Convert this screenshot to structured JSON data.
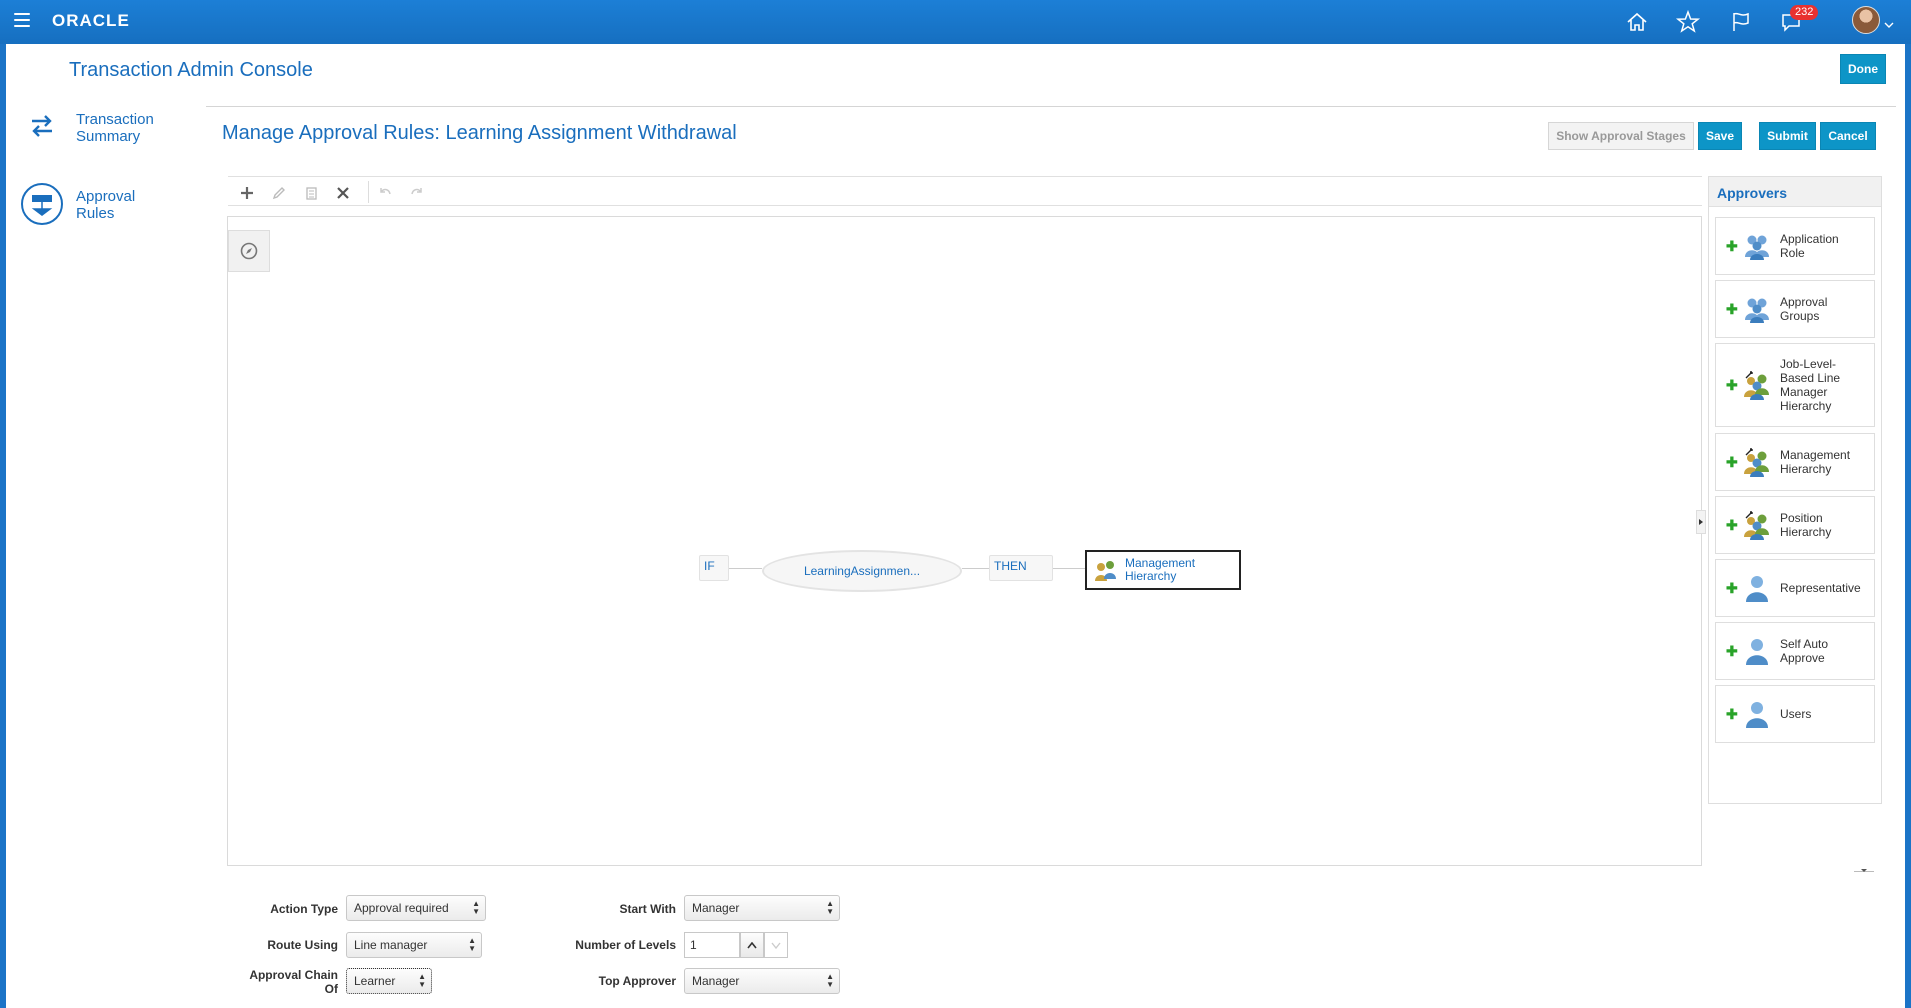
{
  "topbar": {
    "logo": "ORACLE",
    "notification_count": "232"
  },
  "console": {
    "title": "Transaction Admin Console",
    "done_label": "Done"
  },
  "nav": {
    "items": [
      {
        "label_line1": "Transaction",
        "label_line2": "Summary"
      },
      {
        "label_line1": "Approval",
        "label_line2": "Rules"
      }
    ]
  },
  "page": {
    "title": "Manage Approval Rules: Learning Assignment Withdrawal",
    "show_stages_label": "Show Approval Stages",
    "save_label": "Save",
    "submit_label": "Submit",
    "cancel_label": "Cancel"
  },
  "rule": {
    "if_label": "IF",
    "condition_label": "LearningAssignmen...",
    "then_label": "THEN",
    "action_line1": "Management",
    "action_line2": "Hierarchy"
  },
  "approvers": {
    "title": "Approvers",
    "items": [
      {
        "lines": [
          "Application",
          "Role"
        ],
        "icon": "group-icon"
      },
      {
        "lines": [
          "Approval",
          "Groups"
        ],
        "icon": "group-icon"
      },
      {
        "lines": [
          "Job-Level-",
          "Based Line",
          "Manager",
          "Hierarchy"
        ],
        "icon": "hierarchy-icon"
      },
      {
        "lines": [
          "Management",
          "Hierarchy"
        ],
        "icon": "hierarchy-icon"
      },
      {
        "lines": [
          "Position",
          "Hierarchy"
        ],
        "icon": "hierarchy-icon"
      },
      {
        "lines": [
          "Representative"
        ],
        "icon": "user-icon"
      },
      {
        "lines": [
          "Self Auto",
          "Approve"
        ],
        "icon": "user-icon"
      },
      {
        "lines": [
          "Users"
        ],
        "icon": "user-icon"
      }
    ]
  },
  "form": {
    "action_type_label": "Action Type",
    "action_type_value": "Approval required",
    "route_using_label": "Route Using",
    "route_using_value": "Line manager",
    "approval_chain_label_line1": "Approval Chain",
    "approval_chain_label_line2": "Of",
    "approval_chain_value": "Learner",
    "start_with_label": "Start With",
    "start_with_value": "Manager",
    "levels_label": "Number of Levels",
    "levels_value": "1",
    "top_approver_label": "Top Approver",
    "top_approver_value": "Manager"
  }
}
